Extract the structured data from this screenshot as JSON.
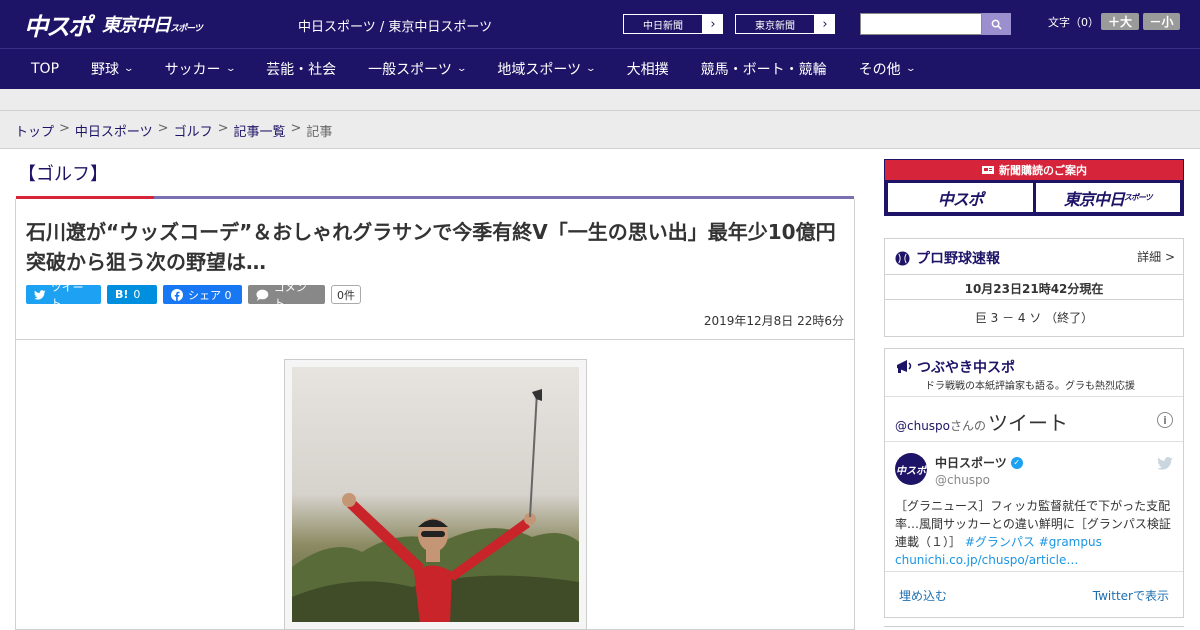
{
  "header": {
    "logo_main": "中スポ",
    "logo_sub": "東京中日",
    "logo_sub_small": "スポーツ",
    "site_names": "中日スポーツ / 東京中日スポーツ",
    "paper_buttons": [
      "中日新聞",
      "東京新聞"
    ],
    "text_size_label": "文字（0）",
    "text_bigger": "＋大",
    "text_smaller": "－小"
  },
  "nav": {
    "items": [
      {
        "label": "TOP",
        "has_menu": false
      },
      {
        "label": "野球",
        "has_menu": true
      },
      {
        "label": "サッカー",
        "has_menu": true
      },
      {
        "label": "芸能・社会",
        "has_menu": false
      },
      {
        "label": "一般スポーツ",
        "has_menu": true
      },
      {
        "label": "地域スポーツ",
        "has_menu": true
      },
      {
        "label": "大相撲",
        "has_menu": false
      },
      {
        "label": "競馬・ボート・競輪",
        "has_menu": false
      },
      {
        "label": "その他",
        "has_menu": true
      }
    ]
  },
  "breadcrumb": [
    {
      "label": "トップ",
      "link": true
    },
    {
      "label": "中日スポーツ",
      "link": true
    },
    {
      "label": "ゴルフ",
      "link": true
    },
    {
      "label": "記事一覧",
      "link": true
    },
    {
      "label": "記事",
      "link": false
    }
  ],
  "article": {
    "category": "【ゴルフ】",
    "headline": "石川遼が“ウッズコーデ”＆おしゃれグラサンで今季有終V「一生の思い出」最年少10億円突破から狙う次の野望は…",
    "share": {
      "tweet": "ツイート",
      "hatena_icon": "B!",
      "hatena_count": "0",
      "facebook": "シェア 0",
      "comment": "コメント",
      "comment_count": "0件"
    },
    "published": "2019年12月8日 22時6分"
  },
  "sidebar": {
    "ad": {
      "title": "新聞購読のご案内",
      "logo1": "中スポ",
      "logo2": "東京中日",
      "logo2_small": "スポーツ"
    },
    "baseball": {
      "title": "プロ野球速報",
      "detail": "詳細 >",
      "timestamp": "10月23日21時42分現在",
      "score": "巨 3 － 4 ソ （終了）"
    },
    "tweets": {
      "title": "つぶやき中スポ",
      "subtitle": "ドラ戦戦の本紙評論家も語る。グラも熱烈応援",
      "handle_prefix": "@chuspo",
      "handle_suffix": "さんの",
      "heading": "ツイート",
      "avatar_text": "中スポ",
      "account_name": "中日スポーツ",
      "account_handle": "@chuspo",
      "text": "［グラニュース］フィッカ監督就任で下がった支配率…風間サッカーとの違い鮮明に［グランパス検証連載（１）］",
      "tags": "#グランパス #grampus",
      "link": "chunichi.co.jp/chuspo/article…",
      "embed": "埋め込む",
      "view_on_twitter": "Twitterで表示"
    }
  },
  "colors": {
    "brand_navy": "#1e1467",
    "accent_red": "#d6253a",
    "accent_purple": "#7a6fb0",
    "twitter_blue": "#1da1f2",
    "facebook_blue": "#1877f2"
  }
}
